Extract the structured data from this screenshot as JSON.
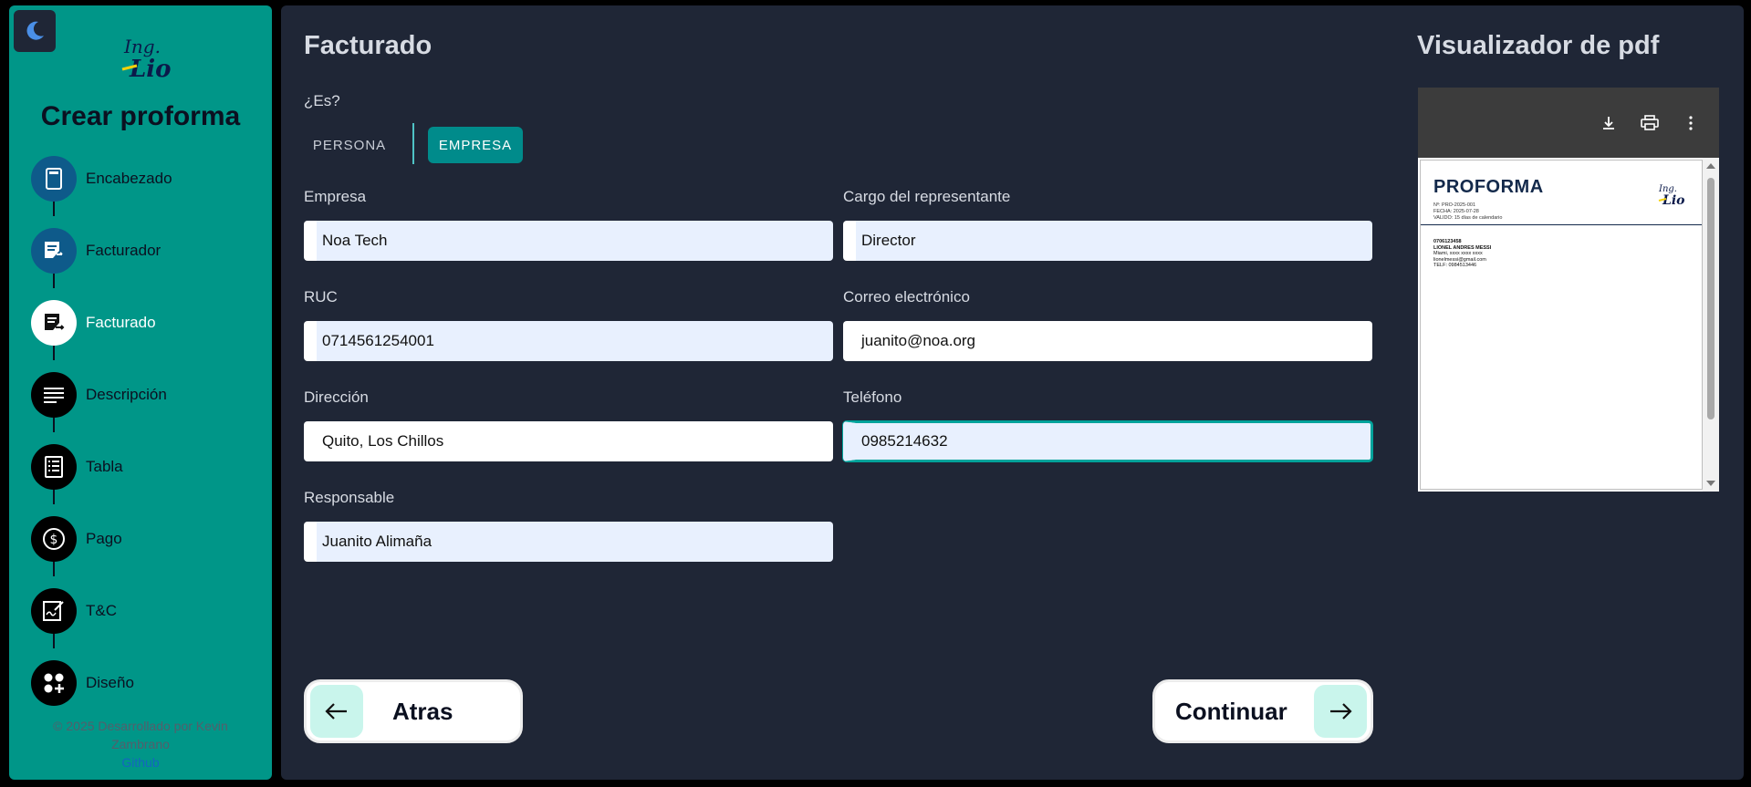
{
  "sidebar": {
    "title": "Crear proforma",
    "steps": [
      {
        "label": "Encabezado",
        "icon": "document-icon",
        "state": "done"
      },
      {
        "label": "Facturador",
        "icon": "receipt-edit-icon",
        "state": "done"
      },
      {
        "label": "Facturado",
        "icon": "receipt-send-icon",
        "state": "active"
      },
      {
        "label": "Descripción",
        "icon": "lines-icon",
        "state": "pending"
      },
      {
        "label": "Tabla",
        "icon": "list-icon",
        "state": "pending"
      },
      {
        "label": "Pago",
        "icon": "dollar-icon",
        "state": "pending"
      },
      {
        "label": "T&C",
        "icon": "signature-icon",
        "state": "pending"
      },
      {
        "label": "Diseño",
        "icon": "apps-add-icon",
        "state": "pending"
      }
    ],
    "footer": {
      "line1": "© 2025 Desarrollado por Kevin",
      "line2": "Zambrano",
      "link": "Github"
    }
  },
  "main": {
    "title": "Facturado",
    "question": "¿Es?",
    "toggle": {
      "persona": "PERSONA",
      "empresa": "EMPRESA",
      "selected": "EMPRESA"
    },
    "fields": {
      "empresa": {
        "label": "Empresa",
        "value": "Noa Tech"
      },
      "cargo": {
        "label": "Cargo del representante",
        "value": "Director"
      },
      "ruc": {
        "label": "RUC",
        "value": "0714561254001"
      },
      "correo": {
        "label": "Correo electrónico",
        "value": "juanito@noa.org"
      },
      "direccion": {
        "label": "Dirección",
        "value": "Quito, Los Chillos"
      },
      "telefono": {
        "label": "Teléfono",
        "value": "0985214632"
      },
      "responsable": {
        "label": "Responsable",
        "value": "Juanito Alimaña"
      }
    },
    "back_label": "Atras",
    "next_label": "Continuar"
  },
  "pdf": {
    "title": "Visualizador de pdf",
    "doc_title": "PROFORMA",
    "meta": [
      "Nº: PRO-2025-001",
      "FECHA: 2025-07-28",
      "VALIDO: 15 días de calendario"
    ],
    "client": [
      "0706123458",
      "LIONEL ANDRES MESSI",
      "Miami, xxxx xxxx xxxx",
      "lionelmessi@gmail.com",
      "TELF: 0984513446"
    ]
  },
  "colors": {
    "accent": "#009688",
    "panel": "#1f2636",
    "active_toggle": "#008b8b"
  }
}
